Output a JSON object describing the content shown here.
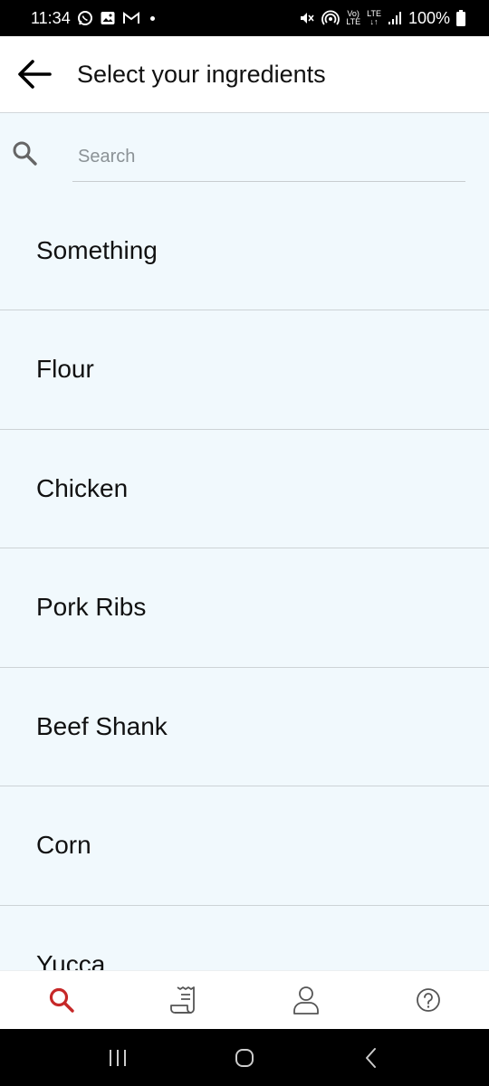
{
  "status_bar": {
    "time": "11:34",
    "battery": "100%",
    "volte": "Vo)",
    "lte1": "LTE",
    "lte2": "LTE",
    "icons": [
      "whatsapp-icon",
      "gallery-icon",
      "gmail-icon",
      "mute-icon",
      "hotspot-icon",
      "signal-icon",
      "battery-icon"
    ]
  },
  "header": {
    "title": "Select your ingredients"
  },
  "search": {
    "placeholder": "Search"
  },
  "ingredients": [
    "Something",
    "Flour",
    "Chicken",
    "Pork Ribs",
    "Beef Shank",
    "Corn",
    "Yucca"
  ],
  "bottom_nav": {
    "active_color": "#c62828",
    "inactive_color": "#555555",
    "items": [
      "search-icon",
      "receipt-icon",
      "profile-icon",
      "help-icon"
    ]
  },
  "system_nav": [
    "recents-icon",
    "home-icon",
    "back-icon"
  ]
}
